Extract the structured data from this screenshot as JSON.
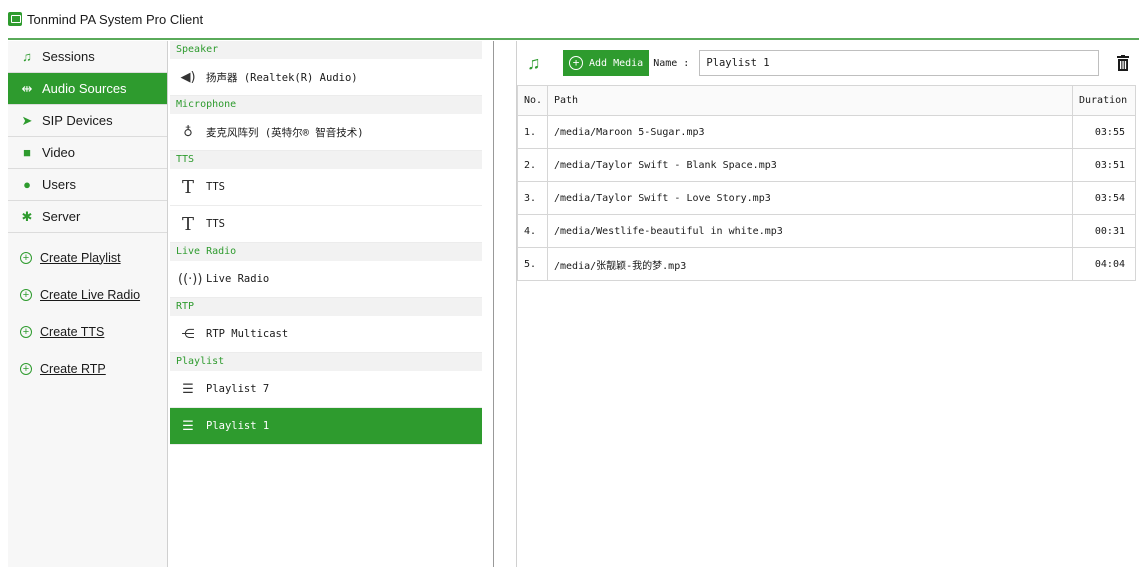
{
  "app": {
    "title": "Tonmind PA System Pro Client"
  },
  "colors": {
    "accent": "#2e9b2e",
    "selected_text": "#ffffff"
  },
  "nav": {
    "items": [
      {
        "label": "Sessions",
        "icon": "music-note-icon"
      },
      {
        "label": "Audio Sources",
        "icon": "arrows-horizontal-icon",
        "active": true
      },
      {
        "label": "SIP Devices",
        "icon": "send-arrow-icon"
      },
      {
        "label": "Video",
        "icon": "video-camera-icon"
      },
      {
        "label": "Users",
        "icon": "user-icon"
      },
      {
        "label": "Server",
        "icon": "gear-icon"
      }
    ],
    "create": [
      "Create Playlist",
      "Create Live Radio",
      "Create TTS",
      "Create RTP"
    ]
  },
  "sources": {
    "categories": [
      {
        "header": "Speaker",
        "items": [
          {
            "label": "扬声器 (Realtek(R) Audio)",
            "icon": "speaker-icon"
          }
        ]
      },
      {
        "header": "Microphone",
        "items": [
          {
            "label": "麦克风阵列 (英特尔® 智音技术)",
            "icon": "microphone-icon"
          }
        ]
      },
      {
        "header": "TTS",
        "items": [
          {
            "label": "TTS",
            "icon": "text-t-icon"
          },
          {
            "label": "TTS",
            "icon": "text-t-icon"
          }
        ]
      },
      {
        "header": "Live Radio",
        "items": [
          {
            "label": "Live Radio",
            "icon": "radio-waves-icon"
          }
        ]
      },
      {
        "header": "RTP",
        "items": [
          {
            "label": "RTP Multicast",
            "icon": "multicast-icon"
          }
        ]
      },
      {
        "header": "Playlist",
        "items": [
          {
            "label": "Playlist 7",
            "icon": "playlist-icon"
          },
          {
            "label": "Playlist 1",
            "icon": "playlist-icon",
            "selected": true
          }
        ]
      }
    ]
  },
  "playlist": {
    "add_media_label": "Add Media",
    "name_label": "Name :",
    "name_value": "Playlist 1",
    "columns": {
      "no": "No.",
      "path": "Path",
      "duration": "Duration"
    },
    "rows": [
      {
        "no": "1.",
        "path": "/media/Maroon 5-Sugar.mp3",
        "duration": "03:55"
      },
      {
        "no": "2.",
        "path": "/media/Taylor Swift - Blank Space.mp3",
        "duration": "03:51"
      },
      {
        "no": "3.",
        "path": "/media/Taylor Swift - Love Story.mp3",
        "duration": "03:54"
      },
      {
        "no": "4.",
        "path": "/media/Westlife-beautiful in white.mp3",
        "duration": "00:31"
      },
      {
        "no": "5.",
        "path": "/media/张靓颖-我的梦.mp3",
        "duration": "04:04"
      }
    ]
  }
}
